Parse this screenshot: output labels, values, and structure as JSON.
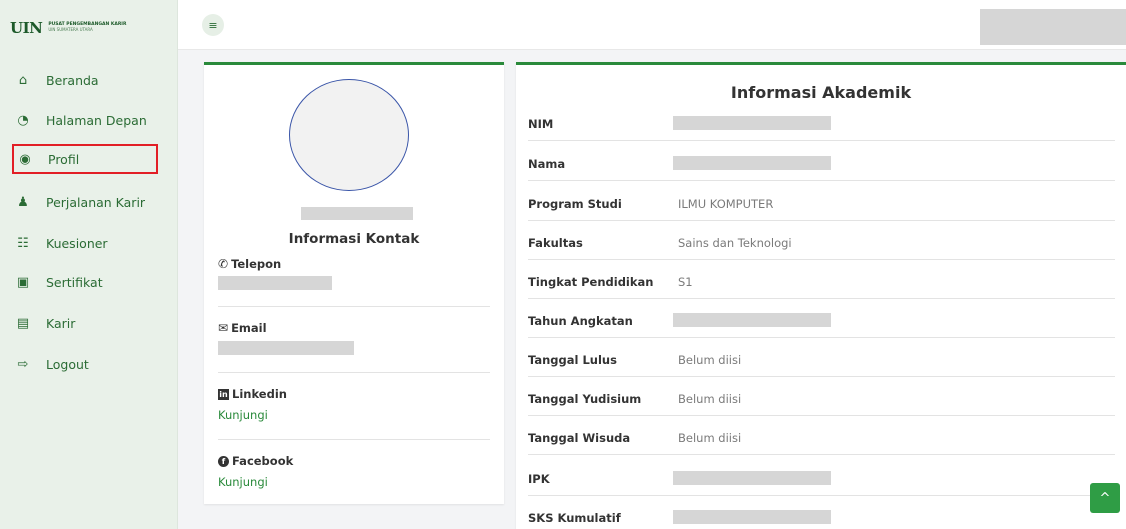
{
  "logo": {
    "mark": "UIN",
    "line1": "PUSAT PENGEMBANGAN KARIR",
    "line2": "UIN SUMATERA UTARA"
  },
  "sidebar": {
    "items": [
      {
        "label": "Beranda",
        "icon": "home-icon",
        "glyph": "⌂"
      },
      {
        "label": "Halaman Depan",
        "icon": "dashboard-icon",
        "glyph": "◔"
      },
      {
        "label": "Profil",
        "icon": "user-circle-icon",
        "glyph": "◉"
      },
      {
        "label": "Perjalanan Karir",
        "icon": "user-career-icon",
        "glyph": "♟"
      },
      {
        "label": "Kuesioner",
        "icon": "list-icon",
        "glyph": "☷"
      },
      {
        "label": "Sertifikat",
        "icon": "certificate-icon",
        "glyph": "▣"
      },
      {
        "label": "Karir",
        "icon": "briefcase-icon",
        "glyph": "▤"
      },
      {
        "label": "Logout",
        "icon": "logout-icon",
        "glyph": "⇨"
      }
    ],
    "active_index": 2
  },
  "topbar": {
    "menu_glyph": "≡"
  },
  "contact": {
    "title": "Informasi Kontak",
    "telepon_label": "Telepon",
    "email_label": "Email",
    "linkedin_label": "Linkedin",
    "linkedin_link": "Kunjungi",
    "facebook_label": "Facebook",
    "facebook_link": "Kunjungi"
  },
  "academic": {
    "title": "Informasi Akademik",
    "rows": [
      {
        "label": "NIM",
        "value": ""
      },
      {
        "label": "Nama",
        "value": ""
      },
      {
        "label": "Program Studi",
        "value": "ILMU KOMPUTER"
      },
      {
        "label": "Fakultas",
        "value": "Sains dan Teknologi"
      },
      {
        "label": "Tingkat Pendidikan",
        "value": "S1"
      },
      {
        "label": "Tahun Angkatan",
        "value": ""
      },
      {
        "label": "Tanggal Lulus",
        "value": "Belum diisi"
      },
      {
        "label": "Tanggal Yudisium",
        "value": "Belum diisi"
      },
      {
        "label": "Tanggal Wisuda",
        "value": "Belum diisi"
      },
      {
        "label": "IPK",
        "value": ""
      },
      {
        "label": "SKS Kumulatif",
        "value": ""
      }
    ]
  },
  "scroll_top_glyph": "^"
}
